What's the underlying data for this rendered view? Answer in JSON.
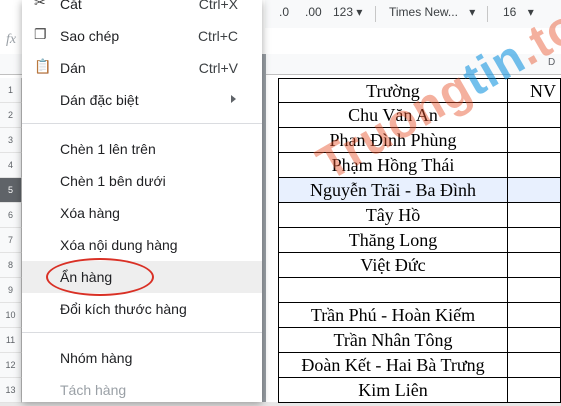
{
  "toolbar": {
    "decrease_decimal": ".0",
    "increase_decimal": ".00",
    "number_format": "123",
    "font_name": "Times New...",
    "font_size": "16"
  },
  "formula_bar": {
    "fx_label": "fx"
  },
  "columns": {
    "d_letter": "D"
  },
  "row_numbers": [
    "1",
    "2",
    "3",
    "4",
    "5",
    "6",
    "7",
    "8",
    "9",
    "10",
    "11",
    "12",
    "13"
  ],
  "selected_row_index": 4,
  "sheet": {
    "header_b": "Trường",
    "header_c": "NV",
    "rows": [
      "Chu Văn An",
      "Phan Đình Phùng",
      "Phạm Hồng Thái",
      "Nguyễn Trãi - Ba Đình",
      "Tây Hồ",
      "Thăng Long",
      "Việt Đức",
      "",
      "Trần Phú - Hoàn Kiếm",
      "Trần Nhân Tông",
      "Đoàn Kết - Hai Bà Trưng",
      "Kim Liên"
    ]
  },
  "context_menu": {
    "cut": {
      "label": "Cắt",
      "shortcut": "Ctrl+X"
    },
    "copy": {
      "label": "Sao chép",
      "shortcut": "Ctrl+C"
    },
    "paste": {
      "label": "Dán",
      "shortcut": "Ctrl+V"
    },
    "paste_special": {
      "label": "Dán đặc biệt"
    },
    "insert_above": {
      "label": "Chèn 1 lên trên"
    },
    "insert_below": {
      "label": "Chèn 1 bên dưới"
    },
    "delete_row": {
      "label": "Xóa hàng"
    },
    "clear_row": {
      "label": "Xóa nội dung hàng"
    },
    "hide_row": {
      "label": "Ẩn hàng"
    },
    "resize_row": {
      "label": "Đổi kích thước hàng"
    },
    "group_row": {
      "label": "Nhóm hàng"
    },
    "ungroup_row": {
      "label": "Tách hàng"
    }
  },
  "watermark": {
    "part1": "Truong",
    "part2": "tin",
    "part3": ".top"
  },
  "colors": {
    "highlight_circle": "#d93025",
    "selected_row": "#e8f0fe"
  }
}
